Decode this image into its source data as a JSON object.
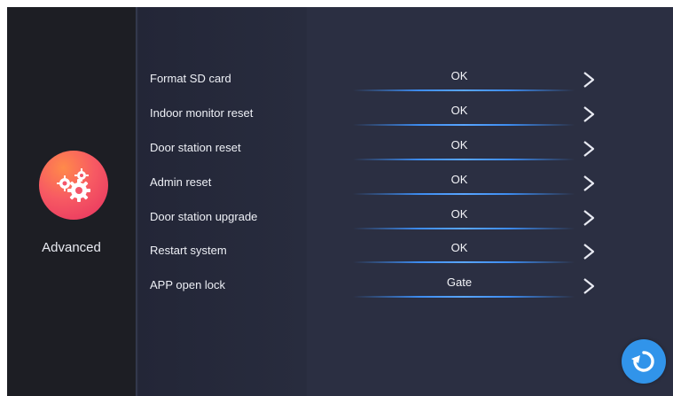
{
  "sidebar": {
    "section_label": "Advanced",
    "icon": "gears-icon"
  },
  "settings": [
    {
      "label": "Format SD card",
      "value": "OK"
    },
    {
      "label": "Indoor monitor reset",
      "value": "OK"
    },
    {
      "label": "Door station reset",
      "value": "OK"
    },
    {
      "label": "Admin reset",
      "value": "OK"
    },
    {
      "label": "Door station upgrade",
      "value": "OK"
    },
    {
      "label": "Restart system",
      "value": "OK"
    },
    {
      "label": "APP open lock",
      "value": "Gate"
    }
  ],
  "footer": {
    "back_icon": "refresh-back-icon"
  },
  "colors": {
    "accent": "#3194ea",
    "gear_gradient_start": "#ff8a4a",
    "gear_gradient_end": "#e6305f",
    "divider_line": "#3d8cf0"
  }
}
